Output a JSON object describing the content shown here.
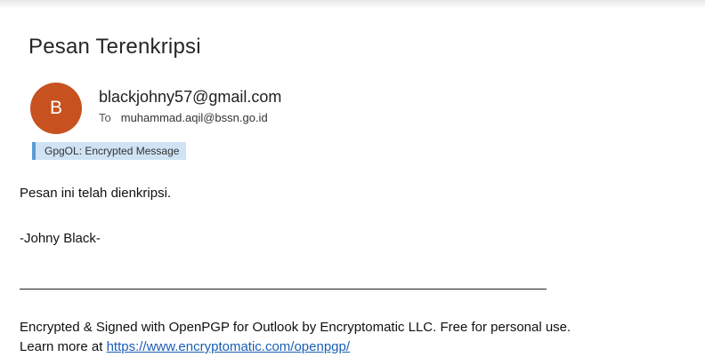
{
  "email": {
    "subject": "Pesan Terenkripsi",
    "sender": {
      "avatar_letter": "B",
      "avatar_color": "#c7521f",
      "address": "blackjohny57@gmail.com"
    },
    "recipient": {
      "label": "To",
      "address": "muhammad.aqil@bssn.go.id"
    },
    "gpg_badge": "GpgOL: Encrypted Message",
    "body_lines": [
      "Pesan ini telah dienkripsi.",
      "-Johny Black-"
    ],
    "footer": {
      "line1": "Encrypted & Signed with OpenPGP for Outlook by Encryptomatic LLC. Free for personal use.",
      "line2_prefix": "Learn more at ",
      "link_text": "https://www.encryptomatic.com/openpgp/"
    }
  }
}
